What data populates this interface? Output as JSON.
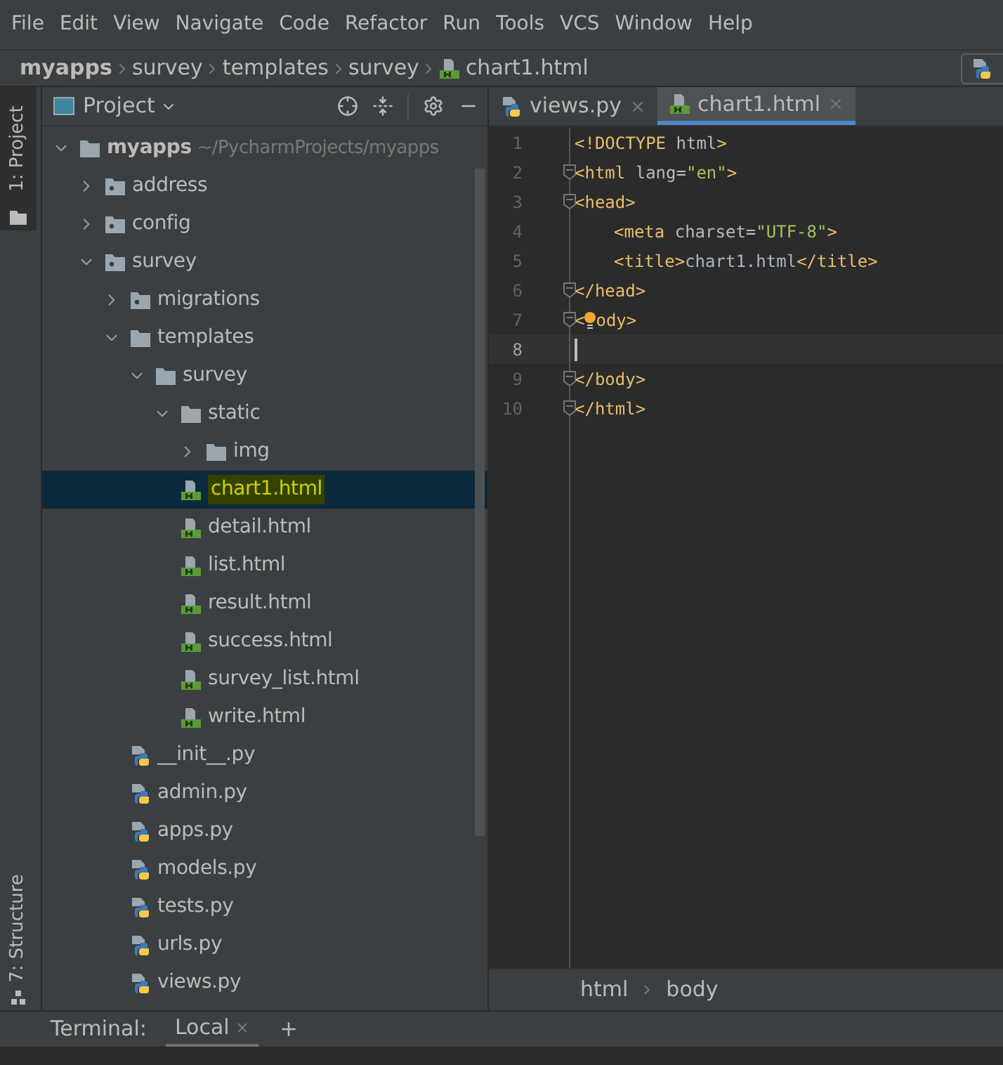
{
  "menu": [
    "File",
    "Edit",
    "View",
    "Navigate",
    "Code",
    "Refactor",
    "Run",
    "Tools",
    "VCS",
    "Window",
    "Help"
  ],
  "breadcrumb": [
    {
      "label": "myapps",
      "kind": "root"
    },
    {
      "label": "survey",
      "kind": "dir"
    },
    {
      "label": "templates",
      "kind": "dir"
    },
    {
      "label": "survey",
      "kind": "dir"
    },
    {
      "label": "chart1.html",
      "kind": "html"
    }
  ],
  "side_tabs": [
    {
      "label": "1: Project",
      "selected": true,
      "kind": "project"
    },
    {
      "label": "7: Structure",
      "selected": false,
      "kind": "structure"
    }
  ],
  "project_panel": {
    "title": "Project",
    "tree": [
      {
        "name": "myapps",
        "path": "~/PycharmProjects/myapps",
        "kind": "folder",
        "expanded": true,
        "selected": false,
        "children": [
          {
            "name": "address",
            "kind": "package",
            "expanded": false,
            "selected": false
          },
          {
            "name": "config",
            "kind": "package",
            "expanded": false,
            "selected": false
          },
          {
            "name": "survey",
            "kind": "package",
            "expanded": true,
            "selected": false,
            "children": [
              {
                "name": "migrations",
                "kind": "package",
                "expanded": false,
                "selected": false
              },
              {
                "name": "templates",
                "kind": "folder",
                "expanded": true,
                "selected": false,
                "children": [
                  {
                    "name": "survey",
                    "kind": "folder",
                    "expanded": true,
                    "selected": false,
                    "children": [
                      {
                        "name": "static",
                        "kind": "folder",
                        "expanded": true,
                        "selected": false,
                        "children": [
                          {
                            "name": "img",
                            "kind": "folder",
                            "expanded": false,
                            "selected": false
                          }
                        ]
                      },
                      {
                        "name": "chart1.html",
                        "kind": "html",
                        "selected": true
                      },
                      {
                        "name": "detail.html",
                        "kind": "html",
                        "selected": false
                      },
                      {
                        "name": "list.html",
                        "kind": "html",
                        "selected": false
                      },
                      {
                        "name": "result.html",
                        "kind": "html",
                        "selected": false
                      },
                      {
                        "name": "success.html",
                        "kind": "html",
                        "selected": false
                      },
                      {
                        "name": "survey_list.html",
                        "kind": "html",
                        "selected": false
                      },
                      {
                        "name": "write.html",
                        "kind": "html",
                        "selected": false
                      }
                    ]
                  }
                ]
              },
              {
                "name": "__init__.py",
                "kind": "py",
                "selected": false
              },
              {
                "name": "admin.py",
                "kind": "py",
                "selected": false
              },
              {
                "name": "apps.py",
                "kind": "py",
                "selected": false
              },
              {
                "name": "models.py",
                "kind": "py",
                "selected": false
              },
              {
                "name": "tests.py",
                "kind": "py",
                "selected": false
              },
              {
                "name": "urls.py",
                "kind": "py",
                "selected": false
              },
              {
                "name": "views.py",
                "kind": "py",
                "selected": false
              }
            ]
          }
        ]
      }
    ]
  },
  "editor_tabs": [
    {
      "label": "views.py",
      "kind": "py",
      "selected": false
    },
    {
      "label": "chart1.html",
      "kind": "html",
      "selected": true
    }
  ],
  "code_lines": [
    {
      "number": "1",
      "fold": false,
      "current": false,
      "tokens": [
        {
          "kind": "tag",
          "text": "<!DOCTYPE "
        },
        {
          "kind": "attr",
          "text": "html"
        },
        {
          "kind": "tag",
          "text": ">"
        }
      ]
    },
    {
      "number": "2",
      "fold": true,
      "current": false,
      "tokens": [
        {
          "kind": "tag",
          "text": "<html "
        },
        {
          "kind": "attr",
          "text": "lang="
        },
        {
          "kind": "string",
          "text": "\"en\""
        },
        {
          "kind": "tag",
          "text": ">"
        }
      ]
    },
    {
      "number": "3",
      "fold": true,
      "current": false,
      "tokens": [
        {
          "kind": "tag",
          "text": "<head>"
        }
      ]
    },
    {
      "number": "4",
      "fold": false,
      "current": false,
      "tokens": [
        {
          "kind": "indent"
        },
        {
          "kind": "tag",
          "text": "<meta "
        },
        {
          "kind": "attr",
          "text": "charset="
        },
        {
          "kind": "string",
          "text": "\"UTF-8\""
        },
        {
          "kind": "tag",
          "text": ">"
        }
      ]
    },
    {
      "number": "5",
      "fold": false,
      "current": false,
      "tokens": [
        {
          "kind": "indent"
        },
        {
          "kind": "tag",
          "text": "<title>"
        },
        {
          "kind": "plain",
          "text": "chart1.html"
        },
        {
          "kind": "tag",
          "text": "</title>"
        }
      ]
    },
    {
      "number": "6",
      "fold": true,
      "current": false,
      "tokens": [
        {
          "kind": "tag",
          "text": "</head>"
        }
      ]
    },
    {
      "number": "7",
      "fold": true,
      "current": false,
      "tokens": [
        {
          "kind": "tag",
          "text": "<"
        },
        {
          "kind": "bulb"
        },
        {
          "kind": "tag",
          "text": "ody>"
        }
      ]
    },
    {
      "number": "8",
      "fold": false,
      "current": true
    },
    {
      "number": "9",
      "fold": true,
      "current": false,
      "tokens": [
        {
          "kind": "tag",
          "text": "</body>"
        }
      ]
    },
    {
      "number": "10",
      "fold": true,
      "current": false,
      "tokens": [
        {
          "kind": "tag",
          "text": "</html>"
        }
      ]
    }
  ],
  "editor_breadcrumb": [
    "html",
    "body"
  ],
  "terminal": {
    "title": "Terminal:",
    "tabs": [
      {
        "label": "Local",
        "selected": true
      }
    ]
  }
}
